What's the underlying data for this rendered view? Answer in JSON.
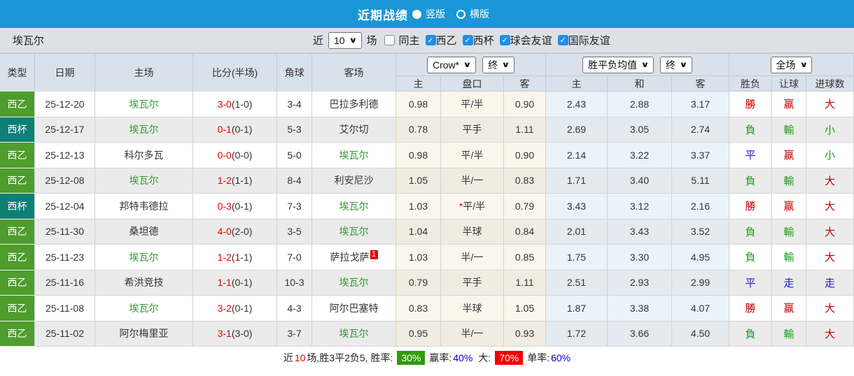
{
  "title_bar": {
    "title": "近期战绩",
    "radio_vertical": "竖版",
    "radio_horizontal": "横版"
  },
  "filter_bar": {
    "team": "埃瓦尔",
    "recent_label": "近",
    "count_value": "10",
    "games_label": "场",
    "checkboxes": [
      {
        "label": "同主",
        "checked": false
      },
      {
        "label": "西乙",
        "checked": true
      },
      {
        "label": "西杯",
        "checked": true
      },
      {
        "label": "球会友谊",
        "checked": true
      },
      {
        "label": "国际友谊",
        "checked": true
      }
    ]
  },
  "header": {
    "type": "类型",
    "date": "日期",
    "home": "主场",
    "score": "比分(半场)",
    "corner": "角球",
    "away": "客场",
    "odds_provider": "Crow*",
    "odds_stage": "终",
    "odds_cols": {
      "home": "主",
      "handicap": "盘口",
      "away": "客"
    },
    "avg_label": "胜平负均值",
    "avg_stage": "终",
    "avg_cols": {
      "home": "主",
      "draw": "和",
      "away": "客"
    },
    "scope": "全场",
    "result_cols": {
      "wdl": "胜负",
      "handicap": "让球",
      "goals": "进球数"
    }
  },
  "rows": [
    {
      "type": "西乙",
      "type_style": "league",
      "date": "25-12-20",
      "home": "埃瓦尔",
      "home_green": true,
      "score": "3-0",
      "half": "(1-0)",
      "corner": "3-4",
      "away": "巴拉多利德",
      "away_green": false,
      "red_card": "",
      "odds_home": "0.98",
      "handicap_star": "",
      "handicap": "平/半",
      "odds_away": "0.90",
      "avg_home": "2.43",
      "avg_draw": "2.88",
      "avg_away": "3.17",
      "res_wdl": "勝",
      "res_wdl_c": "r",
      "res_hcp": "赢",
      "res_hcp_c": "r",
      "res_goal": "大",
      "res_goal_c": "r"
    },
    {
      "type": "西杯",
      "type_style": "cup",
      "date": "25-12-17",
      "home": "埃瓦尔",
      "home_green": true,
      "score": "0-1",
      "half": "(0-1)",
      "corner": "5-3",
      "away": "艾尔切",
      "away_green": false,
      "red_card": "",
      "odds_home": "0.78",
      "handicap_star": "",
      "handicap": "平手",
      "odds_away": "1.11",
      "avg_home": "2.69",
      "avg_draw": "3.05",
      "avg_away": "2.74",
      "res_wdl": "負",
      "res_wdl_c": "g",
      "res_hcp": "輸",
      "res_hcp_c": "g",
      "res_goal": "小",
      "res_goal_c": "g"
    },
    {
      "type": "西乙",
      "type_style": "league",
      "date": "25-12-13",
      "home": "科尔多瓦",
      "home_green": false,
      "score": "0-0",
      "half": "(0-0)",
      "corner": "5-0",
      "away": "埃瓦尔",
      "away_green": true,
      "red_card": "",
      "odds_home": "0.98",
      "handicap_star": "",
      "handicap": "平/半",
      "odds_away": "0.90",
      "avg_home": "2.14",
      "avg_draw": "3.22",
      "avg_away": "3.37",
      "res_wdl": "平",
      "res_wdl_c": "b",
      "res_hcp": "赢",
      "res_hcp_c": "r",
      "res_goal": "小",
      "res_goal_c": "g"
    },
    {
      "type": "西乙",
      "type_style": "league",
      "date": "25-12-08",
      "home": "埃瓦尔",
      "home_green": true,
      "score": "1-2",
      "half": "(1-1)",
      "corner": "8-4",
      "away": "利安尼沙",
      "away_green": false,
      "red_card": "",
      "odds_home": "1.05",
      "handicap_star": "",
      "handicap": "半/一",
      "odds_away": "0.83",
      "avg_home": "1.71",
      "avg_draw": "3.40",
      "avg_away": "5.11",
      "res_wdl": "負",
      "res_wdl_c": "g",
      "res_hcp": "輸",
      "res_hcp_c": "g",
      "res_goal": "大",
      "res_goal_c": "r"
    },
    {
      "type": "西杯",
      "type_style": "cup",
      "date": "25-12-04",
      "home": "邦特韦德拉",
      "home_green": false,
      "score": "0-3",
      "half": "(0-1)",
      "corner": "7-3",
      "away": "埃瓦尔",
      "away_green": true,
      "red_card": "",
      "odds_home": "1.03",
      "handicap_star": "*",
      "handicap": "平/半",
      "odds_away": "0.79",
      "avg_home": "3.43",
      "avg_draw": "3.12",
      "avg_away": "2.16",
      "res_wdl": "勝",
      "res_wdl_c": "r",
      "res_hcp": "赢",
      "res_hcp_c": "r",
      "res_goal": "大",
      "res_goal_c": "r"
    },
    {
      "type": "西乙",
      "type_style": "league",
      "date": "25-11-30",
      "home": "桑坦德",
      "home_green": false,
      "score": "4-0",
      "half": "(2-0)",
      "corner": "3-5",
      "away": "埃瓦尔",
      "away_green": true,
      "red_card": "",
      "odds_home": "1.04",
      "handicap_star": "",
      "handicap": "半球",
      "odds_away": "0.84",
      "avg_home": "2.01",
      "avg_draw": "3.43",
      "avg_away": "3.52",
      "res_wdl": "負",
      "res_wdl_c": "g",
      "res_hcp": "輸",
      "res_hcp_c": "g",
      "res_goal": "大",
      "res_goal_c": "r"
    },
    {
      "type": "西乙",
      "type_style": "league",
      "date": "25-11-23",
      "home": "埃瓦尔",
      "home_green": true,
      "score": "1-2",
      "half": "(1-1)",
      "corner": "7-0",
      "away": "萨拉戈萨",
      "away_green": false,
      "red_card": "1",
      "odds_home": "1.03",
      "handicap_star": "",
      "handicap": "半/一",
      "odds_away": "0.85",
      "avg_home": "1.75",
      "avg_draw": "3.30",
      "avg_away": "4.95",
      "res_wdl": "負",
      "res_wdl_c": "g",
      "res_hcp": "輸",
      "res_hcp_c": "g",
      "res_goal": "大",
      "res_goal_c": "r"
    },
    {
      "type": "西乙",
      "type_style": "league",
      "date": "25-11-16",
      "home": "希洪竞技",
      "home_green": false,
      "score": "1-1",
      "half": "(0-1)",
      "corner": "10-3",
      "away": "埃瓦尔",
      "away_green": true,
      "red_card": "",
      "odds_home": "0.79",
      "handicap_star": "",
      "handicap": "平手",
      "odds_away": "1.11",
      "avg_home": "2.51",
      "avg_draw": "2.93",
      "avg_away": "2.99",
      "res_wdl": "平",
      "res_wdl_c": "b",
      "res_hcp": "走",
      "res_hcp_c": "b",
      "res_goal": "走",
      "res_goal_c": "b"
    },
    {
      "type": "西乙",
      "type_style": "league",
      "date": "25-11-08",
      "home": "埃瓦尔",
      "home_green": true,
      "score": "3-2",
      "half": "(0-1)",
      "corner": "4-3",
      "away": "阿尔巴塞特",
      "away_green": false,
      "red_card": "",
      "odds_home": "0.83",
      "handicap_star": "",
      "handicap": "半球",
      "odds_away": "1.05",
      "avg_home": "1.87",
      "avg_draw": "3.38",
      "avg_away": "4.07",
      "res_wdl": "勝",
      "res_wdl_c": "r",
      "res_hcp": "赢",
      "res_hcp_c": "r",
      "res_goal": "大",
      "res_goal_c": "r"
    },
    {
      "type": "西乙",
      "type_style": "league",
      "date": "25-11-02",
      "home": "阿尔梅里亚",
      "home_green": false,
      "score": "3-1",
      "half": "(3-0)",
      "corner": "3-7",
      "away": "埃瓦尔",
      "away_green": true,
      "red_card": "",
      "odds_home": "0.95",
      "handicap_star": "",
      "handicap": "半/一",
      "odds_away": "0.93",
      "avg_home": "1.72",
      "avg_draw": "3.66",
      "avg_away": "4.50",
      "res_wdl": "負",
      "res_wdl_c": "g",
      "res_hcp": "輸",
      "res_hcp_c": "g",
      "res_goal": "大",
      "res_goal_c": "r"
    }
  ],
  "summary": {
    "part1": "近",
    "count": "10",
    "part2": "场,胜3平2负5, 胜率:",
    "win_rate": "30%",
    "label_win": "赢率:",
    "win_pct": "40%",
    "label_big": "大:",
    "big_pct": "70%",
    "label_single": "单率:",
    "single_pct": "60%"
  },
  "colors": {
    "topbar_blue": "#1a96d6",
    "league_badge_green": "#4f9d2d",
    "cup_badge_teal": "#0d8076",
    "team_highlight_green": "#2e9b2e",
    "score_red": "#e60000",
    "result_red": "#c40000",
    "result_green": "#1f9c1f",
    "result_blue": "#1b1bc8",
    "rate_box_green": "#2e9c0a",
    "rate_box_red": "#f40000",
    "pct_blue": "#0000e0",
    "checkbox_blue": "#1f8fe8"
  }
}
